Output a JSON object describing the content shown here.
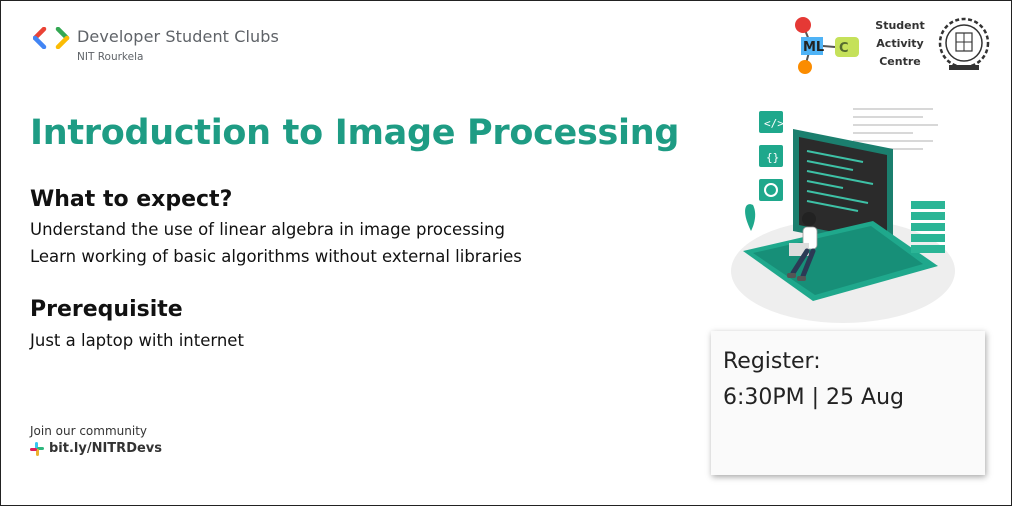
{
  "header": {
    "org_name": "Developer Student Clubs",
    "org_sub": "NIT Rourkela",
    "sac_lines": [
      "Student",
      "Activity",
      "Centre"
    ],
    "left_logo_icon": "gdsc-brackets-icon",
    "mlc_logo_icon": "ml-club-logo-icon",
    "nit_logo_icon": "nit-rourkela-seal-icon"
  },
  "main": {
    "title": "Introduction to Image Processing",
    "expect_heading": "What to expect?",
    "expect_items": [
      "Understand the use of linear algebra in image processing",
      "Learn working of basic algorithms without external libraries"
    ],
    "prereq_heading": "Prerequisite",
    "prereq_text": "Just a laptop with internet"
  },
  "community": {
    "label": "Join our community",
    "url": "bit.ly/NITRDevs",
    "icon": "slack-icon"
  },
  "register": {
    "label": "Register:",
    "time": "6:30PM | 25 Aug"
  },
  "illustration": {
    "icon": "developer-laptop-illustration"
  },
  "colors": {
    "accent": "#1e9c84",
    "text": "#111111",
    "muted": "#5f6368"
  }
}
